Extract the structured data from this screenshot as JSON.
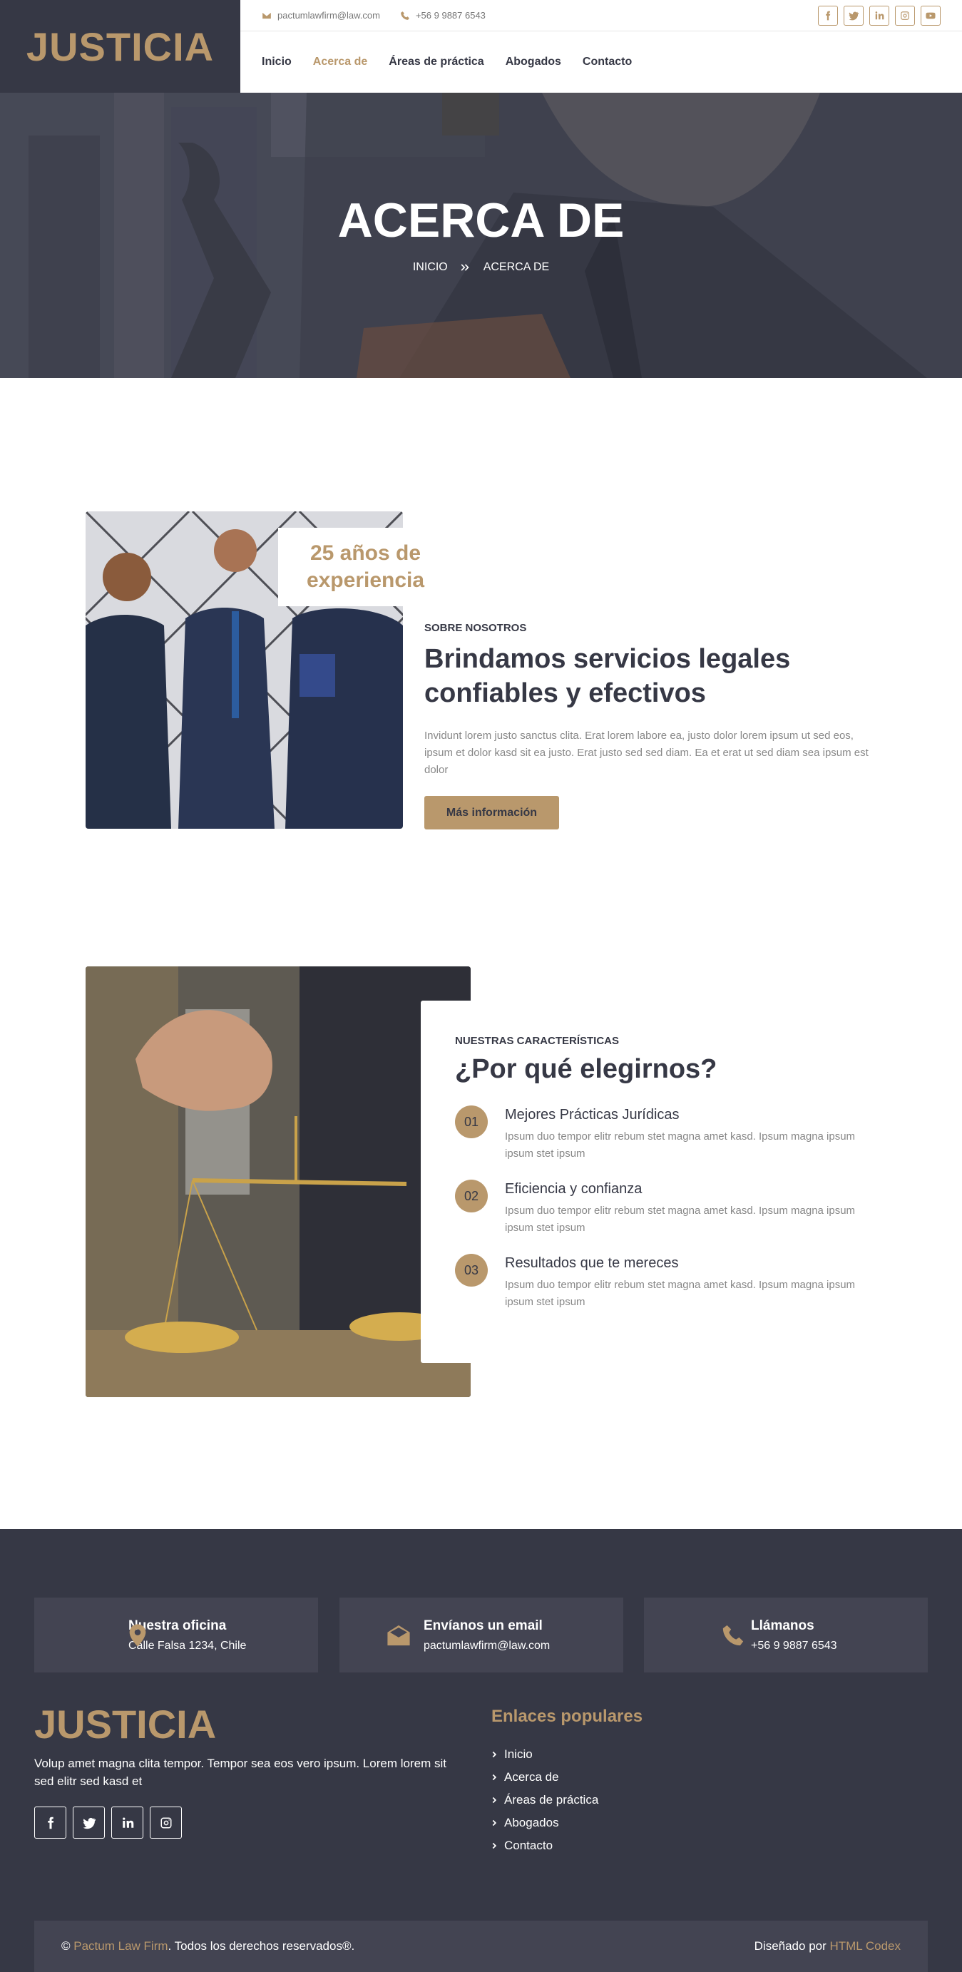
{
  "brand": {
    "logo": "JUSTICIA"
  },
  "topbar": {
    "email": "pactumlawfirm@law.com",
    "phone": "+56 9 9887 6543"
  },
  "nav": {
    "items": [
      "Inicio",
      "Acerca de",
      "Áreas de práctica",
      "Abogados",
      "Contacto"
    ],
    "active": "Acerca de"
  },
  "hero": {
    "title": "ACERCA DE",
    "crumb_home": "INICIO",
    "crumb_current": "ACERCA DE"
  },
  "about": {
    "experience_line1": "25 años de",
    "experience_line2": "experiencia",
    "kicker": "SOBRE NOSOTROS",
    "heading": "Brindamos servicios legales confiables y efectivos",
    "text": "Invidunt lorem justo sanctus clita. Erat lorem labore ea, justo dolor lorem ipsum ut sed eos, ipsum et dolor kasd sit ea justo. Erat justo sed sed diam. Ea et erat ut sed diam sea ipsum est dolor",
    "button": "Más información"
  },
  "features": {
    "kicker": "NUESTRAS CARACTERÍSTICAS",
    "heading": "¿Por qué elegirnos?",
    "items": [
      {
        "num": "01",
        "title": "Mejores Prácticas Jurídicas",
        "desc": "Ipsum duo tempor elitr rebum stet magna amet kasd. Ipsum magna ipsum ipsum stet ipsum"
      },
      {
        "num": "02",
        "title": "Eficiencia y confianza",
        "desc": "Ipsum duo tempor elitr rebum stet magna amet kasd. Ipsum magna ipsum ipsum stet ipsum"
      },
      {
        "num": "03",
        "title": "Resultados que te mereces",
        "desc": "Ipsum duo tempor elitr rebum stet magna amet kasd. Ipsum magna ipsum ipsum stet ipsum"
      }
    ]
  },
  "footer": {
    "office_title": "Nuestra oficina",
    "office_value": "Calle Falsa 1234, Chile",
    "email_title": "Envíanos un email",
    "email_value": "pactumlawfirm@law.com",
    "call_title": "Llámanos",
    "call_value": "+56 9 9887 6543",
    "logo": "JUSTICIA",
    "text": "Volup amet magna clita tempor. Tempor sea eos vero ipsum. Lorem lorem sit sed elitr sed kasd et",
    "links_title": "Enlaces populares",
    "links": [
      "Inicio",
      "Acerca de",
      "Áreas de práctica",
      "Abogados",
      "Contacto"
    ],
    "copy_symbol": "©",
    "copy_firm": "Pactum Law Firm",
    "copy_rest": ". Todos los derechos reservados®.",
    "designed_by": "Diseñado por ",
    "designer": "HTML Codex"
  },
  "colors": {
    "accent": "#b9986c",
    "dark": "#363845",
    "panel": "#434452"
  }
}
